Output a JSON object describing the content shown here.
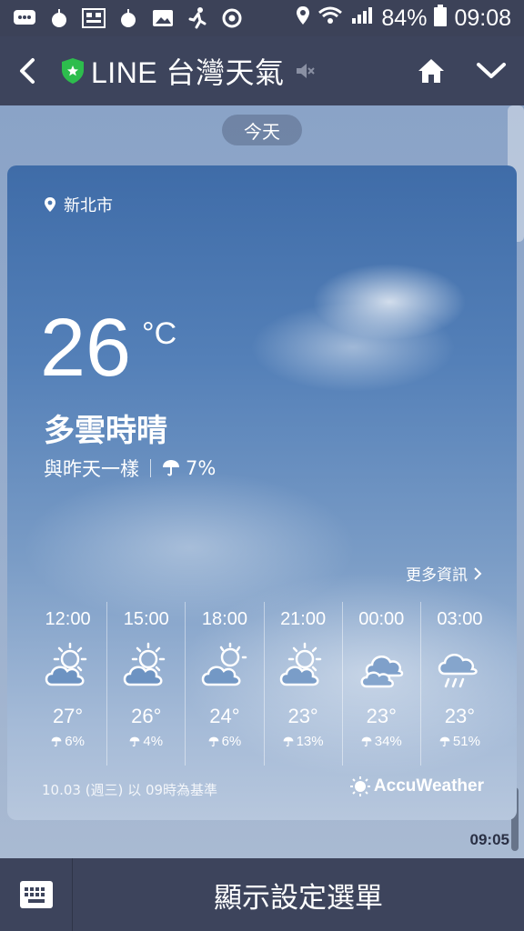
{
  "status_bar": {
    "battery": "84%",
    "time": "09:08",
    "icons": [
      "chat-icon",
      "apple-icon",
      "qr-icon",
      "apple-icon",
      "image-icon",
      "runner-icon",
      "chrome-icon",
      "location-icon",
      "wifi-icon",
      "signal-icon",
      "battery-icon"
    ]
  },
  "app_bar": {
    "title": "LINE 台灣天氣",
    "icons": [
      "back-icon",
      "shield-icon",
      "mute-icon",
      "home-icon",
      "chevron-down-icon"
    ]
  },
  "chat": {
    "date_label": "今天",
    "message_time": "09:05"
  },
  "weather": {
    "location": "新北市",
    "temperature": "26",
    "unit": "°C",
    "condition": "多雲時晴",
    "comparison": "與昨天一樣",
    "rain_chance": "7%",
    "more_info": "更多資訊",
    "hourly": [
      {
        "time": "12:00",
        "temp": "27°",
        "rain": "6%",
        "icon": "sun-cloud-icon"
      },
      {
        "time": "15:00",
        "temp": "26°",
        "rain": "4%",
        "icon": "sun-cloud-icon"
      },
      {
        "time": "18:00",
        "temp": "24°",
        "rain": "6%",
        "icon": "sun-cloud-icon"
      },
      {
        "time": "21:00",
        "temp": "23°",
        "rain": "13%",
        "icon": "sun-cloud-icon"
      },
      {
        "time": "00:00",
        "temp": "23°",
        "rain": "34%",
        "icon": "cloud-icon"
      },
      {
        "time": "03:00",
        "temp": "23°",
        "rain": "51%",
        "icon": "rain-cloud-icon"
      }
    ],
    "footer": "10.03 (週三) 以 09時為基準",
    "provider": "AccuWeather"
  },
  "bottom_bar": {
    "menu_label": "顯示設定選單"
  },
  "colors": {
    "bar_bg": "#3d445c",
    "status_bg": "#3c4258",
    "shield_green": "#2dbd4d"
  }
}
